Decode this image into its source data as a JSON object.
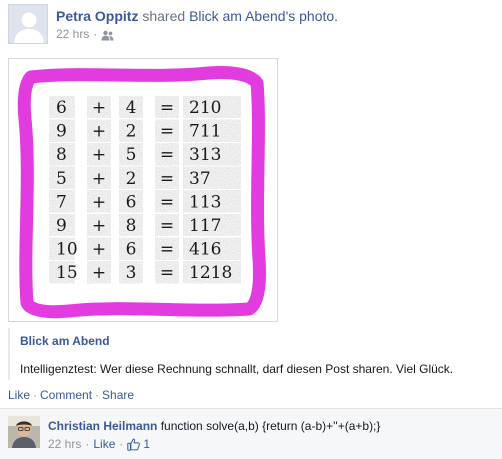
{
  "post": {
    "author": "Petra Oppitz",
    "action_text": "shared",
    "source_page": "Blick am Abend",
    "source_suffix": "'s photo.",
    "timestamp": "22 hrs",
    "meta_separator": "·",
    "privacy_icon": "friends-icon"
  },
  "puzzle": {
    "border_color": "#e23be0",
    "rows": [
      {
        "a": "6",
        "op": "+",
        "b": "4",
        "eq": "=",
        "result": "210"
      },
      {
        "a": "9",
        "op": "+",
        "b": "2",
        "eq": "=",
        "result": "711"
      },
      {
        "a": "8",
        "op": "+",
        "b": "5",
        "eq": "=",
        "result": "313"
      },
      {
        "a": "5",
        "op": "+",
        "b": "2",
        "eq": "=",
        "result": "37"
      },
      {
        "a": "7",
        "op": "+",
        "b": "6",
        "eq": "=",
        "result": "113"
      },
      {
        "a": "9",
        "op": "+",
        "b": "8",
        "eq": "=",
        "result": "117"
      },
      {
        "a": "10",
        "op": "+",
        "b": "6",
        "eq": "=",
        "result": "416"
      },
      {
        "a": "15",
        "op": "+",
        "b": "3",
        "eq": "=",
        "result": "1218"
      }
    ]
  },
  "shared": {
    "title": "Blick am Abend",
    "description": "Intelligenztest: Wer diese Rechnung schnallt, darf diesen Post sharen. Viel Glück."
  },
  "actions": {
    "like": "Like",
    "comment": "Comment",
    "share": "Share",
    "separator": "·"
  },
  "comment": {
    "author": "Christian Heilmann",
    "text": "function solve(a,b) {return (a-b)+''+(a+b);}",
    "timestamp": "22 hrs",
    "like": "Like",
    "like_count": "1",
    "separator": "·"
  },
  "colors": {
    "link": "#3b5998",
    "muted": "#90949c",
    "comment_bg": "#f6f7f9"
  }
}
